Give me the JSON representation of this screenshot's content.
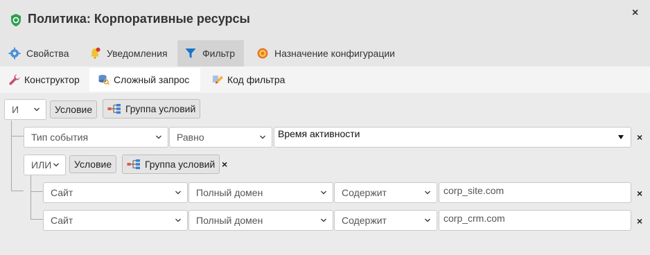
{
  "window": {
    "title": "Политика: Корпоративные ресурсы",
    "close": "×"
  },
  "tabs": [
    {
      "label": "Свойства",
      "icon": "gear-icon"
    },
    {
      "label": "Уведомления",
      "icon": "bell-icon"
    },
    {
      "label": "Фильтр",
      "icon": "funnel-icon",
      "active": true
    },
    {
      "label": "Назначение конфигурации",
      "icon": "target-icon"
    }
  ],
  "subtabs": [
    {
      "label": "Конструктор",
      "icon": "wrench-icon"
    },
    {
      "label": "Сложный запрос",
      "icon": "query-icon",
      "active": true
    },
    {
      "label": "Код фильтра",
      "icon": "pencil-icon"
    }
  ],
  "filter": {
    "root_operator": "И",
    "add_condition": "Условие",
    "add_group": "Группа условий",
    "condition1": {
      "field": "Тип события",
      "operator": "Равно",
      "value": "Время активности"
    },
    "group": {
      "operator": "ИЛИ",
      "add_condition": "Условие",
      "add_group": "Группа условий",
      "rows": [
        {
          "field": "Сайт",
          "subfield": "Полный домен",
          "operator": "Содержит",
          "value": "corp_site.com"
        },
        {
          "field": "Сайт",
          "subfield": "Полный домен",
          "operator": "Содержит",
          "value": "corp_crm.com"
        }
      ]
    },
    "remove": "×"
  },
  "colors": {
    "accent": "#1a73c8",
    "shield": "#2e9e4f",
    "tab_active": "#d3d3d3"
  }
}
